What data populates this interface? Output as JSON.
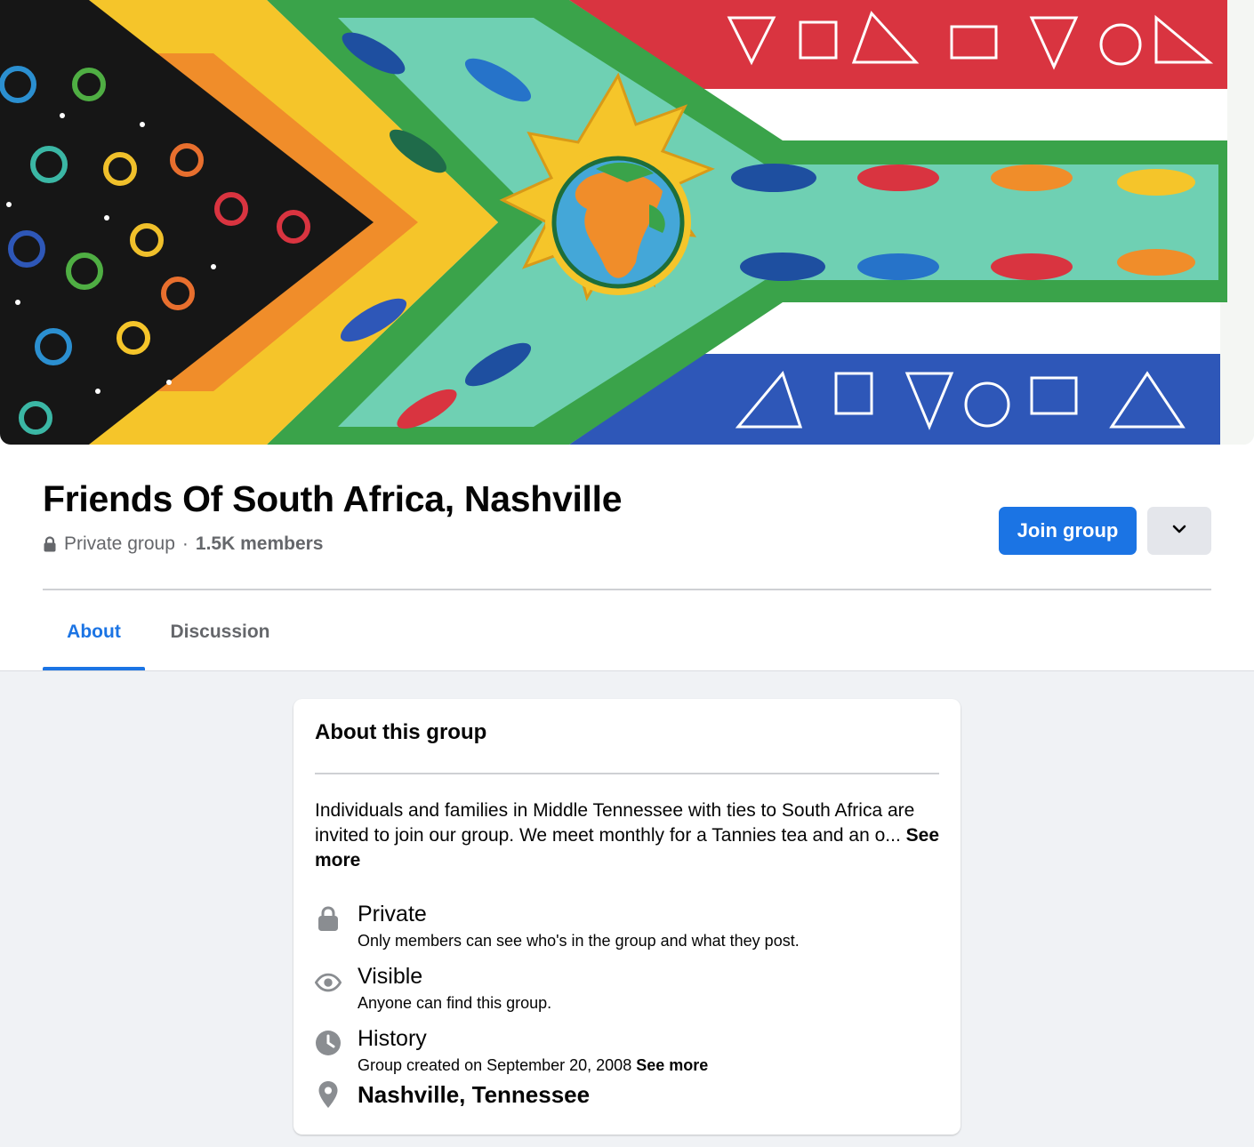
{
  "group": {
    "title": "Friends Of South Africa, Nashville",
    "privacy": "Private group",
    "separator": "·",
    "members": "1.5K members"
  },
  "actions": {
    "join_label": "Join group",
    "more_icon": "chevron-down-icon"
  },
  "tabs": [
    {
      "label": "About",
      "active": true
    },
    {
      "label": "Discussion",
      "active": false
    }
  ],
  "about": {
    "title": "About this group",
    "description": "Individuals and families in Middle Tennessee with ties to South Africa are invited to join our group. We meet monthly for a Tannies tea and an o...",
    "see_more": "See more",
    "items": [
      {
        "icon": "lock-icon",
        "title": "Private",
        "subtitle": "Only members can see who's in the group and what they post."
      },
      {
        "icon": "eye-icon",
        "title": "Visible",
        "subtitle": "Anyone can find this group."
      },
      {
        "icon": "clock-icon",
        "title": "History",
        "subtitle": "Group created on September 20, 2008",
        "see_more": "See more"
      },
      {
        "icon": "location-pin-icon",
        "title": "Nashville, Tennessee"
      }
    ]
  },
  "colors": {
    "accent": "#1b74e4",
    "secondary_text": "#65676b",
    "page_background": "#f0f2f5",
    "icon_gray": "#8a8d91"
  }
}
